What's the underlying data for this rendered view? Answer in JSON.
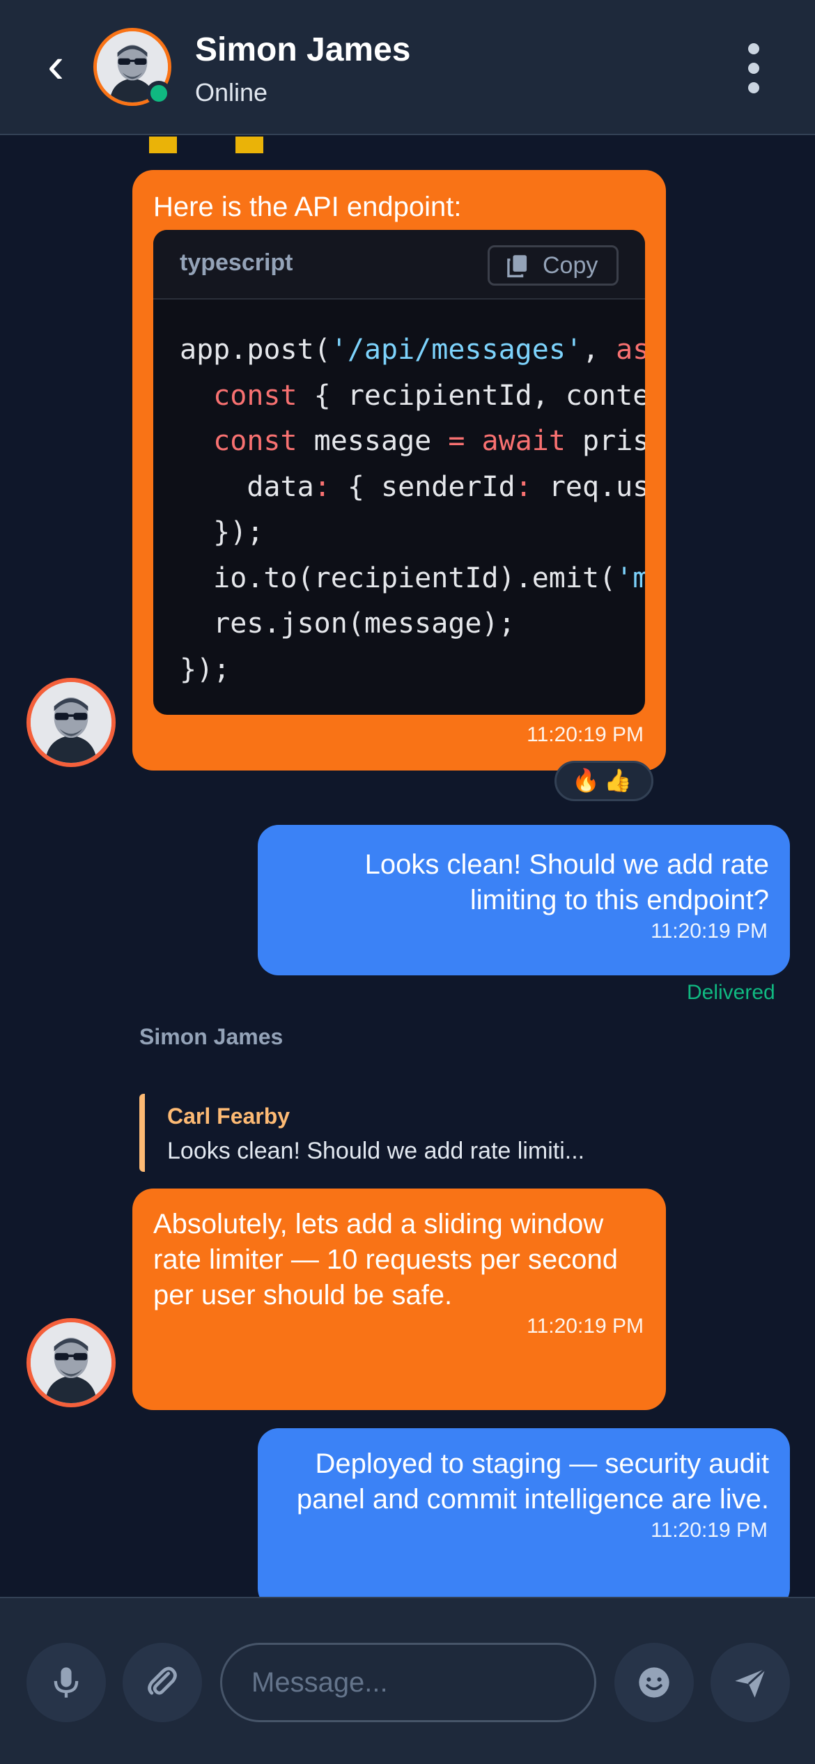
{
  "header": {
    "back_icon": "chevron-left-icon",
    "contact_name": "Simon James",
    "status": "Online",
    "status_color": "#10b981",
    "menu_icon": "more-vertical-icon"
  },
  "messages": [
    {
      "direction": "incoming",
      "text": "Here is the API endpoint:",
      "code": {
        "language": "typescript",
        "copy_label": "Copy",
        "lines": [
          "app.post('/api/messages', asy",
          "  const { recipientId, conter",
          "  const message = await prisr",
          "    data: { senderId: req.use",
          "  });",
          "  io.to(recipientId).emit('me",
          "  res.json(message);",
          "});"
        ]
      },
      "time": "11:20:19 PM",
      "reactions": "🔥👍"
    },
    {
      "direction": "outgoing",
      "text": "Looks clean! Should we add rate limiting to this endpoint?",
      "time": "11:20:19 PM",
      "receipt": "Delivered"
    },
    {
      "direction": "incoming",
      "sender": "Simon James",
      "reply_to": {
        "author": "Carl Fearby",
        "text": "Looks clean! Should we add rate limiti..."
      },
      "text": "Absolutely, lets add a sliding window rate limiter — 10 requests per second per user should be safe.",
      "time": "11:20:19 PM"
    },
    {
      "direction": "outgoing",
      "text": "Deployed to staging — security audit panel and commit intelligence are live.",
      "time": "11:20:19 PM"
    }
  ],
  "composer": {
    "placeholder": "Message...",
    "mic_icon": "microphone-icon",
    "attach_icon": "paperclip-icon",
    "emoji_icon": "emoji-icon",
    "send_icon": "send-icon"
  },
  "colors": {
    "incoming_bubble": "#f97316",
    "outgoing_bubble": "#3b82f6",
    "background": "#0f172a",
    "header": "#1e293b"
  }
}
